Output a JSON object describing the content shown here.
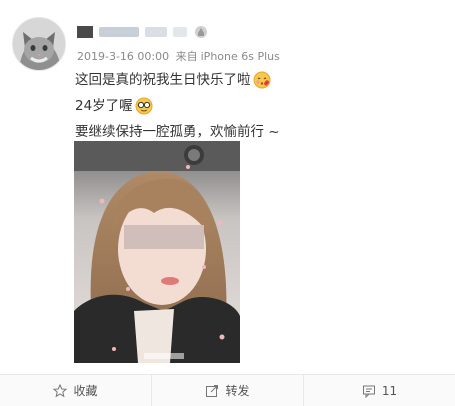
{
  "post": {
    "meta_time": "2019-3-16 00:00",
    "meta_from": "来自",
    "meta_device": "iPhone 6s Plus",
    "lines": [
      "这回是真的祝我生日快乐了啦",
      "24岁了喔",
      "要继续保持一腔孤勇，欢愉前行 ~"
    ]
  },
  "toolbar": {
    "favorite_label": "收藏",
    "repost_label": "转发",
    "comment_count": "11"
  },
  "colors": {
    "text": "#333333",
    "meta": "#8a8a8a",
    "toolbar_bg": "#fafafa",
    "divider": "#e8e8e8"
  },
  "icons": {
    "favorite": "star-icon",
    "repost": "repost-icon",
    "comment": "comment-icon"
  }
}
